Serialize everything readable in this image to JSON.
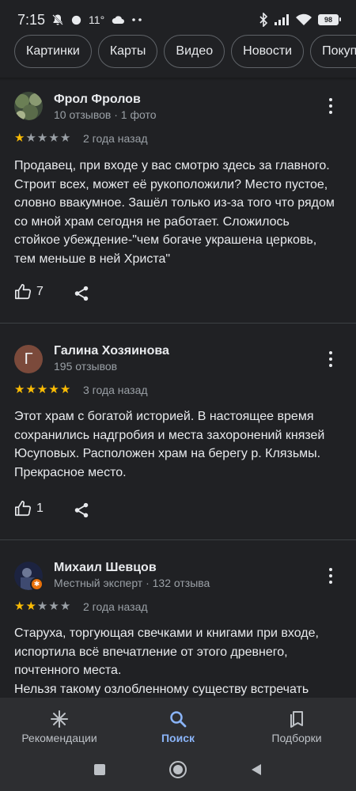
{
  "status_bar": {
    "time": "7:15",
    "temperature": "11°",
    "battery": "98"
  },
  "chips": [
    "Картинки",
    "Карты",
    "Видео",
    "Новости",
    "Покупки"
  ],
  "reviews": [
    {
      "name": "Фрол Фролов",
      "meta": "10 отзывов · 1 фото",
      "rating": 1,
      "date": "2 года назад",
      "text": "Продавец, при входе у вас смотрю здесь за главного. Строит всех, может её рукоположили? Место пустое, словно ввакумное. Зашёл только из-за того что рядом со мной храм сегодня не работает. Сложилось стойкое убеждение-\"чем богаче украшена церковь, тем меньше в ней Христа\"",
      "likes": "7"
    },
    {
      "name": "Галина Хозяинова",
      "avatar_letter": "Г",
      "meta": "195 отзывов",
      "rating": 5,
      "date": "3 года назад",
      "text": "Этот храм с богатой историей. В настоящее время сохранились надгробия и места захоронений князей Юсуповых. Расположен храм на берегу р. Клязьмы. Прекрасное место.",
      "likes": "1"
    },
    {
      "name": "Михаил Шевцов",
      "meta": "Местный эксперт · 132 отзыва",
      "rating": 2,
      "date": "2 года назад",
      "text": "Старуха, торгующая свечками и книгами при входе, испортила всё впечатление от этого древнего, почтенного места.\nНельзя такому озлобленному существу встречать"
    }
  ],
  "bottom_nav": [
    {
      "label": "Рекомендации",
      "icon": "asterisk-icon",
      "active": false
    },
    {
      "label": "Поиск",
      "icon": "search-icon",
      "active": true
    },
    {
      "label": "Подборки",
      "icon": "collections-icon",
      "active": false
    }
  ],
  "colors": {
    "background": "#202124",
    "star": "#fbbc04",
    "accent": "#8ab4f8"
  }
}
